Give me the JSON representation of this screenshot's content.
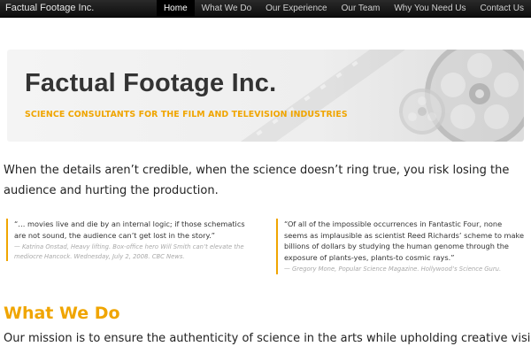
{
  "header": {
    "brand": "Factual Footage Inc.",
    "nav": [
      {
        "label": "Home",
        "active": true
      },
      {
        "label": "What We Do",
        "active": false
      },
      {
        "label": "Our Experience",
        "active": false
      },
      {
        "label": "Our Team",
        "active": false
      },
      {
        "label": "Why You Need Us",
        "active": false
      },
      {
        "label": "Contact Us",
        "active": false
      }
    ]
  },
  "hero": {
    "title": "Factual Footage Inc.",
    "subtitle": "SCIENCE CONSULTANTS FOR THE FILM AND TELEVISION INDUSTRIES"
  },
  "intro": "When the details aren’t credible, when the science doesn’t ring true, you risk losing the audience and hurting the production.",
  "quotes": [
    {
      "text": "“… movies live and die by an internal logic; if those schematics are not sound, the audience can’t get lost in the story.”",
      "cite": "— Katrina Onstad, Heavy lifting. Box-office hero Will Smith can’t elevate the mediocre Hancock. Wednesday, July 2, 2008. CBC News."
    },
    {
      "text": "“Of all of the impossible occurrences in Fantastic Four, none seems as implausible as scientist Reed Richards’ scheme to make billions of dollars by studying the human genome through the exposure of plants-yes, plants-to cosmic rays.”",
      "cite": "— Gregory Mone, Popular Science Magazine. Hollywood’s Science Guru."
    }
  ],
  "what_we_do": {
    "heading": "What We Do",
    "mission": "Our mission is to ensure the authenticity of science in the arts while upholding creative vision."
  },
  "colors": {
    "accent": "#f0a500",
    "nav_bg": "#1a1a1a",
    "hero_bg": "#eeeeee"
  }
}
